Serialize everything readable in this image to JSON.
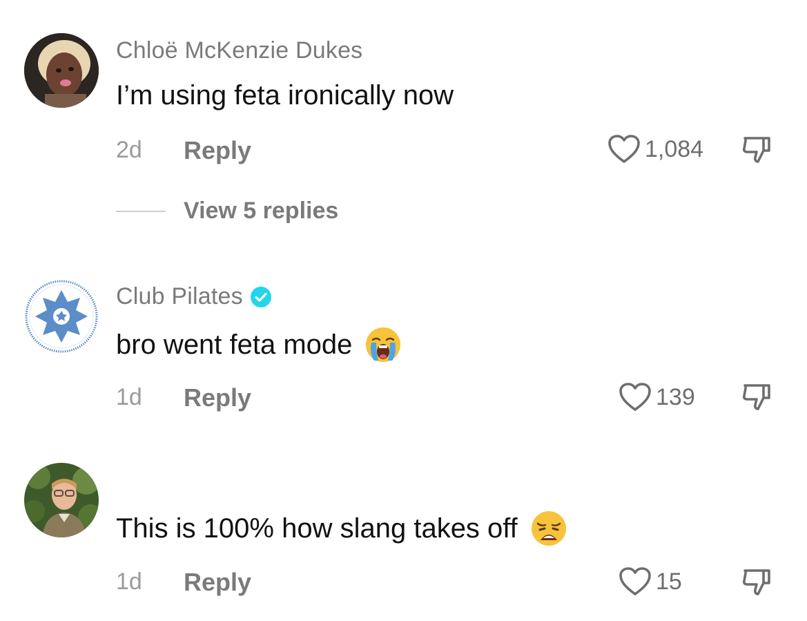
{
  "comments": [
    {
      "username": "Chloë McKenzie Dukes",
      "text": "I’m using feta ironically now",
      "age": "2d",
      "reply_label": "Reply",
      "likes": "1,084",
      "view_replies": "View 5 replies"
    },
    {
      "username": "Club Pilates",
      "verified": true,
      "text": "bro went feta mode",
      "emoji": "loudly-crying-face",
      "age": "1d",
      "reply_label": "Reply",
      "likes": "139"
    },
    {
      "username": "",
      "text": "This is 100% how slang takes off",
      "emoji": "weary-face",
      "age": "1d",
      "reply_label": "Reply",
      "likes": "15"
    }
  ],
  "colors": {
    "username": "#7a7a7a",
    "text": "#111111",
    "meta": "#9a9a9a",
    "verified": "#20d5ec",
    "club_pilates_blue": "#5b8dc9"
  },
  "icons": {
    "like": "heart-outline-icon",
    "dislike": "thumbs-down-icon",
    "verified": "verified-badge-icon"
  }
}
